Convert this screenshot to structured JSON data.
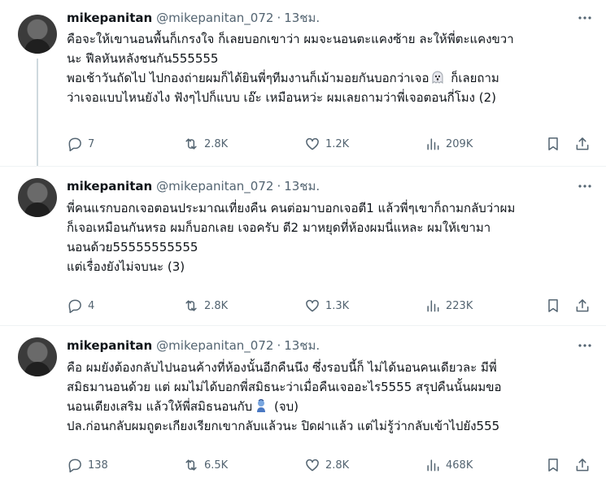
{
  "tweets": [
    {
      "name": "mikepanitan",
      "handle": "@mikepanitan_072",
      "dot": "·",
      "time": "13ชม.",
      "lines": [
        "คือจะให้เขานอนพื้นก็เกรงใจ ก็เลยบอกเขาว่า ผมจะนอนตะแคงซ้าย ละให้พี่ตะแคงขวา",
        "นะ ฟีลหันหลังชนกัน555555",
        "พอเช้าวันถัดไป ไปกองถ่ายผมก็ได้ยินพี่ๆทีมงานก็เม้ามอยกันบอกว่าเจอ",
        "ว่าเจอแบบไหนยังไง ฟังๆไปก็แบบ เอ๊ะ เหมือนหว่ะ ผมเลยถามว่าพี่เจอตอนกี่โมง (2)"
      ],
      "line3_after_emoji": " ก็เลยถาม",
      "emoji": "ghost-emoji",
      "replies": "7",
      "retweets": "2.8K",
      "likes": "1.2K",
      "views": "209K"
    },
    {
      "name": "mikepanitan",
      "handle": "@mikepanitan_072",
      "dot": "·",
      "time": "13ชม.",
      "lines": [
        "พี่คนแรกบอกเจอตอนประมาณเที่ยงคืน คนต่อมาบอกเจอตี1 แล้วพี่ๆเขาก็ถามกลับว่าผม",
        "ก็เจอเหมือนกันหรอ ผมก็บอกเลย เจอครับ ตี2 มาหยุดที่ห้องผมนี่แหละ ผมให้เขามา",
        "นอนด้วย55555555555",
        "แต่เรื่องยังไม่จบนะ (3)"
      ],
      "replies": "4",
      "retweets": "2.8K",
      "likes": "1.3K",
      "views": "223K"
    },
    {
      "name": "mikepanitan",
      "handle": "@mikepanitan_072",
      "dot": "·",
      "time": "13ชม.",
      "lines": [
        "คือ ผมยังต้องกลับไปนอนค้างที่ห้องนั้นอีกคืนนึง ซึ่งรอบนี้ก็ ไม่ได้นอนคนเดียวละ มีพี่",
        "สมิธมานอนด้วย แต่ ผมไม่ได้บอกพี่สมิธนะว่าเมื่อคืนเจออะไร5555 สรุปคืนนั้นผมขอ",
        "นอนเตียงเสริม แล้วให้พี่สมิธนอนกับ",
        "ปล.ก่อนกลับผมถูตะเกียงเรียกเขากลับแล้วนะ ปิดฝาแล้ว แต่ไม่รู้ว่ากลับเข้าไปยัง555"
      ],
      "line3_after_emoji": " (จบ)",
      "emoji": "genie-emoji",
      "replies": "138",
      "retweets": "6.5K",
      "likes": "2.8K",
      "views": "468K"
    }
  ],
  "colors": {
    "text": "#0f1419",
    "secondary": "#536471",
    "thread_line": "#cfd9de",
    "divider": "#eff3f4"
  },
  "icons": [
    "more-icon",
    "reply-icon",
    "retweet-icon",
    "like-icon",
    "views-icon",
    "bookmark-icon",
    "share-icon"
  ]
}
